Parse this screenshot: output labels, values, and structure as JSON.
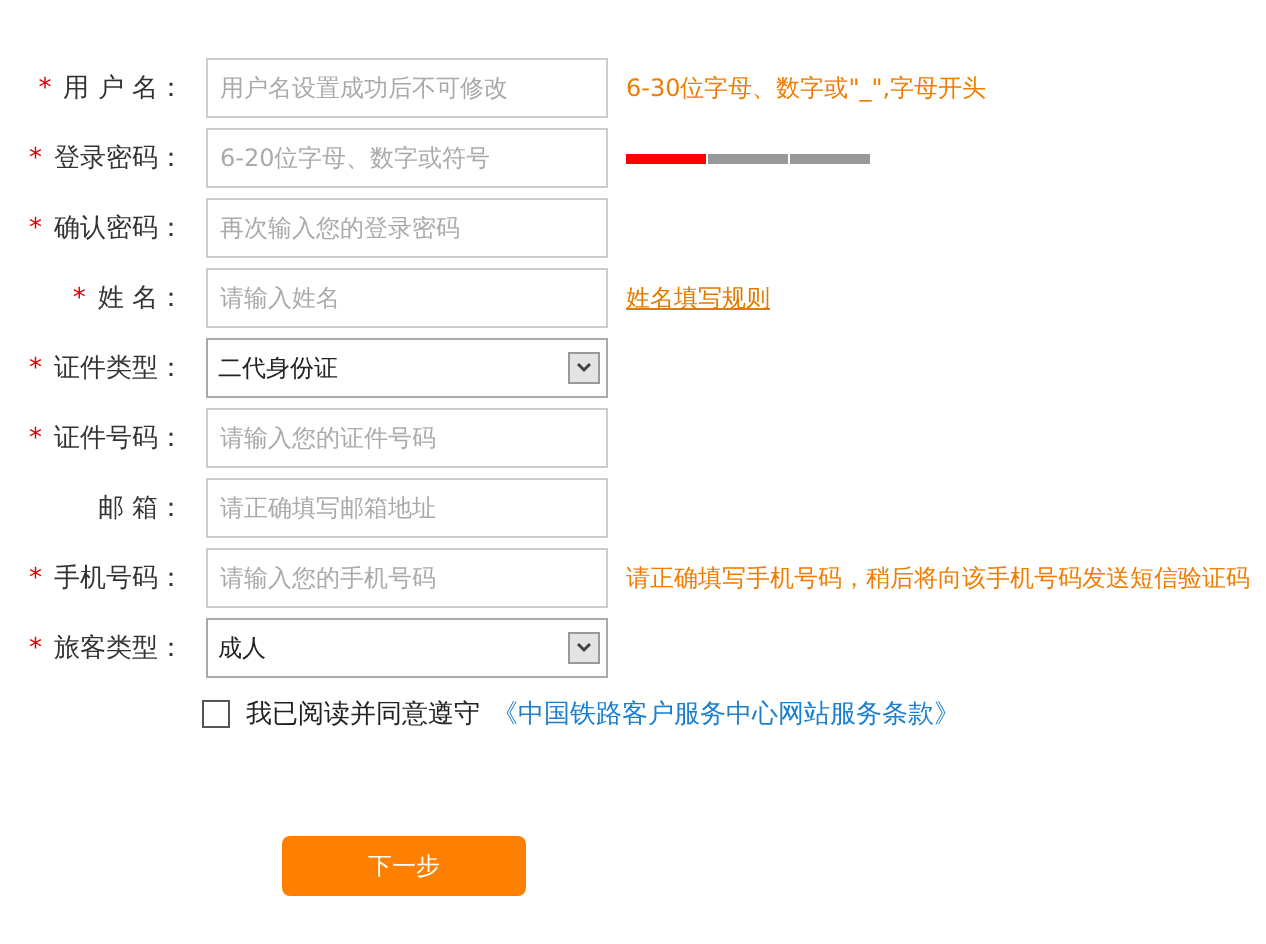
{
  "form": {
    "fields": [
      {
        "label": "用 户 名：",
        "required_mark": "*",
        "kind": "text",
        "placeholder": "用户名设置成功后不可修改",
        "hint": {
          "kind": "text",
          "text": "6-30位字母、数字或\"_\",字母开头"
        }
      },
      {
        "label": "登录密码：",
        "required_mark": "*",
        "kind": "text",
        "placeholder": "6-20位字母、数字或符号",
        "hint": {
          "kind": "meter",
          "level": 0.33
        }
      },
      {
        "label": "确认密码：",
        "required_mark": "*",
        "kind": "text",
        "placeholder": "再次输入您的登录密码"
      },
      {
        "label": "姓 名：",
        "required_mark": "*",
        "kind": "text",
        "placeholder": "请输入姓名",
        "hint": {
          "kind": "link",
          "text": "姓名填写规则"
        }
      },
      {
        "label": "证件类型：",
        "required_mark": "*",
        "kind": "select",
        "value": "二代身份证"
      },
      {
        "label": "证件号码：",
        "required_mark": "*",
        "kind": "text",
        "placeholder": "请输入您的证件号码"
      },
      {
        "label": "邮 箱：",
        "kind": "text",
        "placeholder": "请正确填写邮箱地址"
      },
      {
        "label": "手机号码：",
        "required_mark": "*",
        "kind": "text",
        "placeholder": "请输入您的手机号码",
        "hint": {
          "kind": "text",
          "text": "请正确填写手机号码，稍后将向该手机号码发送短信验证码"
        }
      },
      {
        "label": "旅客类型：",
        "required_mark": "*",
        "kind": "select",
        "value": "成人"
      }
    ]
  },
  "agreement": {
    "checked": false,
    "text": "我已阅读并同意遵守",
    "link": "《中国铁路客户服务中心网站服务条款》"
  },
  "next_button": "下一步"
}
